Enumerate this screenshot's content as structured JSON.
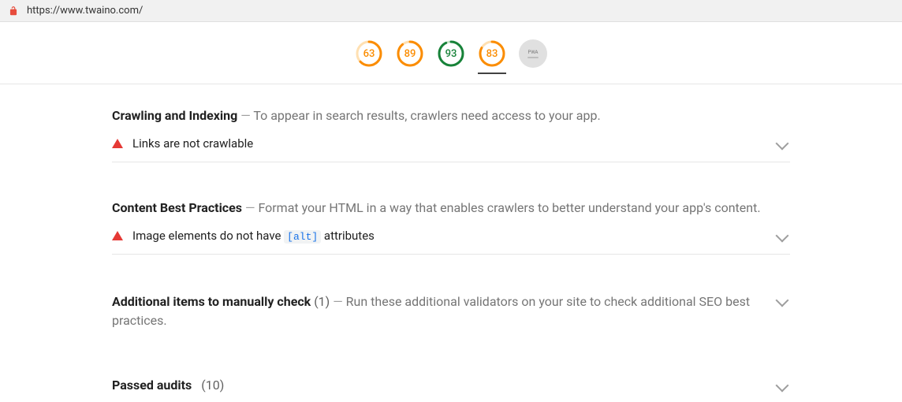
{
  "url_bar": {
    "url": "https://www.twaino.com/"
  },
  "gauges": [
    {
      "value": 63,
      "color": "orange",
      "active": false
    },
    {
      "value": 89,
      "color": "orange",
      "active": false
    },
    {
      "value": 93,
      "color": "green",
      "active": false
    },
    {
      "value": 83,
      "color": "orange",
      "active": true
    }
  ],
  "pwa_label": "PWA",
  "sections": {
    "crawling": {
      "title": "Crawling and Indexing",
      "dash": "—",
      "desc": "To appear in search results, crawlers need access to your app.",
      "audit": "Links are not crawlable"
    },
    "content_bp": {
      "title": "Content Best Practices",
      "dash": "—",
      "desc": "Format your HTML in a way that enables crawlers to better understand your app's content.",
      "audit_pre": "Image elements do not have ",
      "audit_code": "[alt]",
      "audit_post": " attributes"
    },
    "manual": {
      "title": "Additional items to manually check",
      "count": "(1)",
      "dash": "—",
      "desc": "Run these additional validators on your site to check additional SEO best practices."
    },
    "passed": {
      "title": "Passed audits",
      "count": "(10)"
    }
  }
}
